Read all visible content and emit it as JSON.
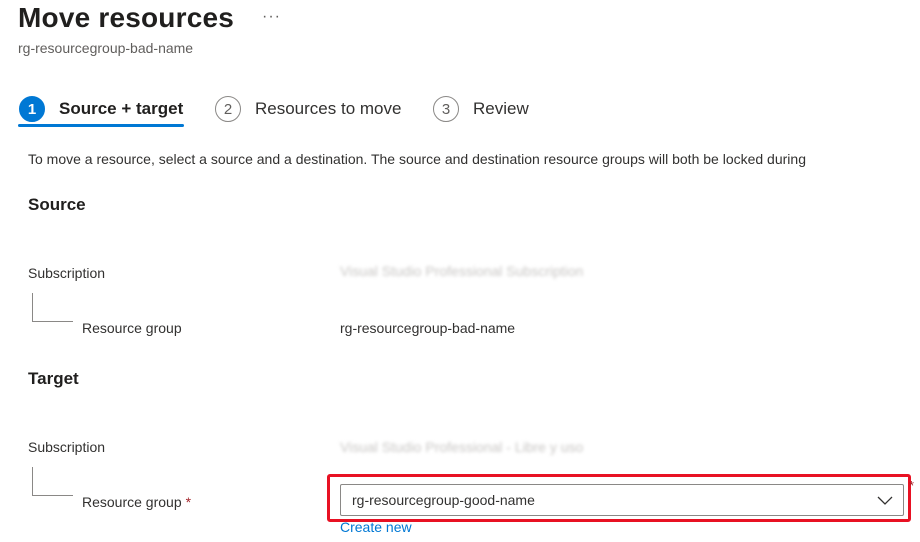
{
  "header": {
    "title": "Move resources",
    "more_icon": "ellipsis-icon",
    "more_label": "···",
    "subtitle": "rg-resourcegroup-bad-name"
  },
  "steps": [
    {
      "number": "1",
      "label": "Source + target",
      "active": true
    },
    {
      "number": "2",
      "label": "Resources to move",
      "active": false
    },
    {
      "number": "3",
      "label": "Review",
      "active": false
    }
  ],
  "description": "To move a resource, select a source and a destination. The source and destination resource groups will both be locked during",
  "source": {
    "heading": "Source",
    "subscription_label": "Subscription",
    "subscription_value": "Visual Studio Professional Subscription",
    "resource_group_label": "Resource group",
    "resource_group_value": "rg-resourcegroup-bad-name"
  },
  "target": {
    "heading": "Target",
    "subscription_label": "Subscription",
    "subscription_value": "Visual Studio Professional - Libre y uso",
    "resource_group_label": "Resource group",
    "required_mark": "*",
    "resource_group_selected": "rg-resourcegroup-good-name",
    "create_new_label": "Create new"
  },
  "colors": {
    "accent": "#0078d4",
    "highlight": "#e81123",
    "required": "#a4262c"
  }
}
